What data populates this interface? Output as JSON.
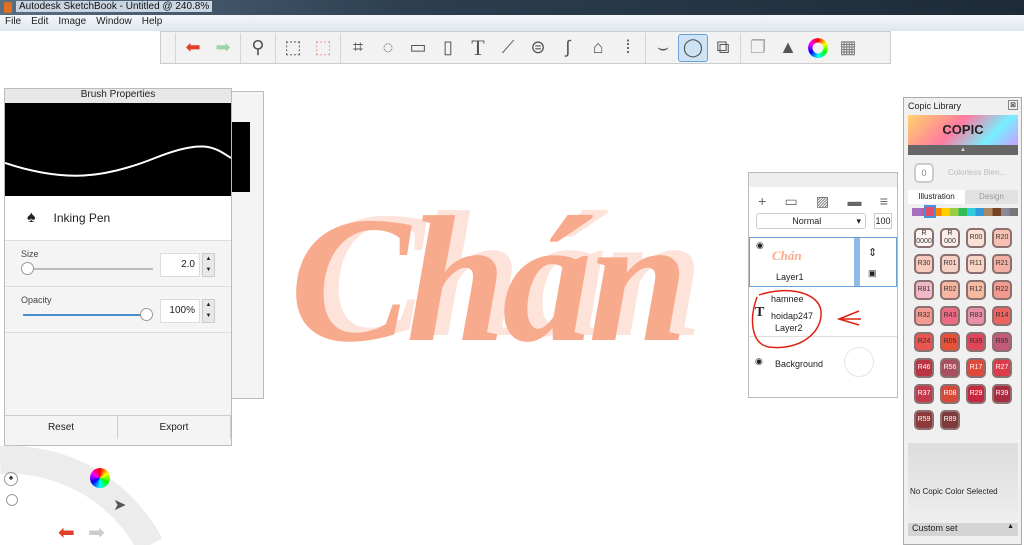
{
  "window": {
    "title": "Autodesk SketchBook - Untitled @ 240.8%"
  },
  "menu": [
    "File",
    "Edit",
    "Image",
    "Window",
    "Help"
  ],
  "toolbar": {
    "icons": [
      "undo-icon",
      "redo-icon",
      "zoom-icon",
      "select-icon",
      "transform-select-icon",
      "crop-icon",
      "lasso-move-icon",
      "distort-icon",
      "fill-bucket-icon",
      "text-icon",
      "ruler-icon",
      "ellipse-guide-icon",
      "french-curve-icon",
      "perspective-icon",
      "symmetry-icon",
      "stroke-stabilizer-icon",
      "ellipse-tool-icon",
      "shapes-icon",
      "copy-paste-icon",
      "brushes-icon",
      "color-wheel-icon",
      "swatches-icon"
    ],
    "selected": "ellipse-tool-icon"
  },
  "canvas": {
    "text": "Chán",
    "color": "#f8ab8c"
  },
  "brush": {
    "title": "Brush Properties",
    "name": "Inking Pen",
    "size_label": "Size",
    "size_value": "2.0",
    "size_fraction": 0.0,
    "opacity_label": "Opacity",
    "opacity_value": "100%",
    "opacity_fraction": 1.0,
    "reset": "Reset",
    "export": "Export"
  },
  "layers": {
    "blend_mode": "Normal",
    "opacity": "100",
    "items": [
      {
        "name": "Layer1",
        "thumb_text": "Chán"
      },
      {
        "name": "Layer2",
        "texts": [
          "hamnee",
          "hoidap247"
        ]
      },
      {
        "name": "Background"
      }
    ]
  },
  "copic": {
    "title": "Copic Library",
    "logo": "COPIC",
    "blender": "0",
    "blender_label": "Colorless Blen...",
    "tabs": [
      "Illustration",
      "Design"
    ],
    "active_tab": "Illustration",
    "colors": [
      [
        "R\n0000",
        "#fdf6f2"
      ],
      [
        "R\n000",
        "#fbeee8"
      ],
      [
        "R00",
        "#fbe0d5"
      ],
      [
        "R20",
        "#f8c1b3"
      ],
      [
        "R30",
        "#f7cabd"
      ],
      [
        "R01",
        "#f7d0c3"
      ],
      [
        "R11",
        "#f9d4c4"
      ],
      [
        "R21",
        "#f5b0a5"
      ],
      [
        "R81",
        "#f0b7c8"
      ],
      [
        "R02",
        "#f7b6a2"
      ],
      [
        "R12",
        "#f7bba3"
      ],
      [
        "R22",
        "#f29a8d"
      ],
      [
        "R32",
        "#f39a91"
      ],
      [
        "R43",
        "#ec6a85"
      ],
      [
        "R83",
        "#e88ea9"
      ],
      [
        "R14",
        "#ec6360"
      ],
      [
        "R24",
        "#e95550"
      ],
      [
        "R05",
        "#e85038"
      ],
      [
        "R35",
        "#e0455a"
      ],
      [
        "R85",
        "#c35a7a"
      ],
      [
        "R46",
        "#bb3444"
      ],
      [
        "R56",
        "#a8505f"
      ],
      [
        "R17",
        "#e04a3a"
      ],
      [
        "R27",
        "#dc3b4b"
      ],
      [
        "R37",
        "#c33a4d"
      ],
      [
        "R08",
        "#d84a38"
      ],
      [
        "R29",
        "#c8283d"
      ],
      [
        "R39",
        "#a82c40"
      ],
      [
        "R59",
        "#8e3a3c"
      ],
      [
        "R89",
        "#7c3a3a"
      ]
    ],
    "status": "No Copic Color Selected",
    "custom_set": "Custom set"
  }
}
